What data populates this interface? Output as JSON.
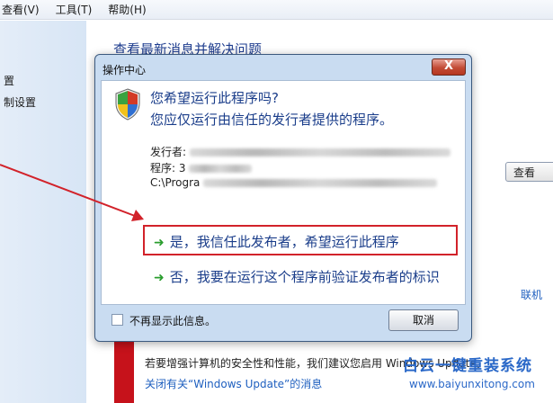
{
  "menu": {
    "view": "查看(V)",
    "tools": "工具(T)",
    "help": "帮助(H)"
  },
  "sidebar": {
    "item1": "置",
    "item2": "制设置"
  },
  "background": {
    "heading": "查看最新消息并解决问题",
    "view_button": "查看",
    "link_right": "联机",
    "wu_text": "若要增强计算机的安全性和性能，我们建议您启用 Windows Update。",
    "wu_link": "关闭有关“Windows Update”的消息"
  },
  "watermark": {
    "title": "白云一键重装系统",
    "url": "www.baiyunxitong.com"
  },
  "dialog": {
    "title": "操作中心",
    "close": "X",
    "question1": "您希望运行此程序吗?",
    "question2": "您应仅运行由信任的发行者提供的程序。",
    "publisher_label": "发行者:",
    "program_label": "程序: 3",
    "path_prefix": "C:\\Progra",
    "option_trust": "是，我信任此发布者，希望运行此程序",
    "option_verify": "否，我要在运行这个程序前验证发布者的标识",
    "checkbox_label": "不再显示此信息。",
    "cancel": "取消"
  },
  "colors": {
    "accent": "#1a3d8a",
    "highlight_border": "#d2222a",
    "green_arrow": "#2a9d2e"
  },
  "icons": {
    "shield": "uac-shield-icon",
    "option": "green-arrow-icon"
  }
}
